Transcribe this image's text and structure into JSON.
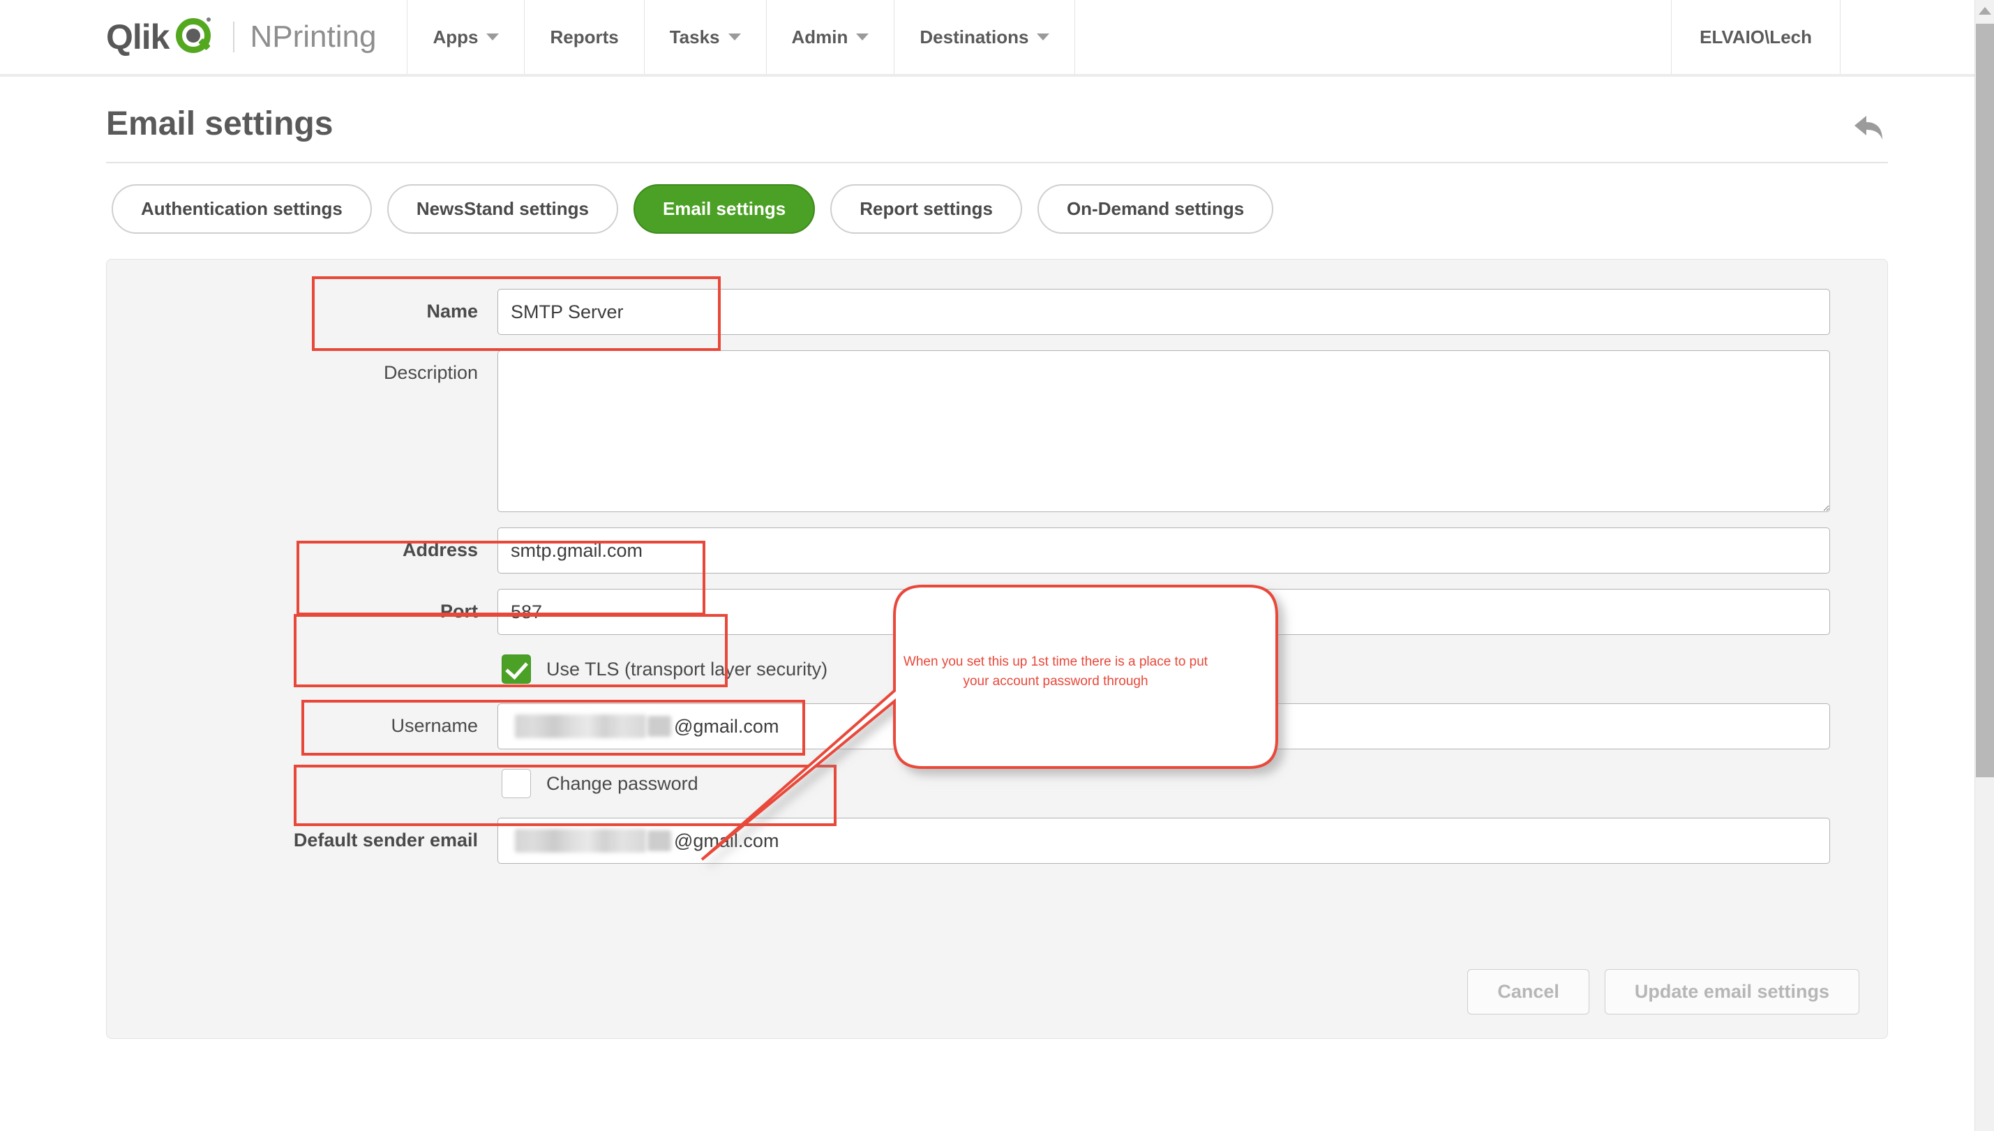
{
  "navbar": {
    "logo": {
      "brand": "Qlik",
      "product": "NPrinting"
    },
    "items": [
      {
        "label": "Apps",
        "has_caret": true
      },
      {
        "label": "Reports",
        "has_caret": false
      },
      {
        "label": "Tasks",
        "has_caret": true
      },
      {
        "label": "Admin",
        "has_caret": true
      },
      {
        "label": "Destinations",
        "has_caret": true
      }
    ],
    "user": "ELVAIO\\Lech"
  },
  "page": {
    "title": "Email settings",
    "back_icon": "back-arrow-icon"
  },
  "tabs": [
    {
      "label": "Authentication settings",
      "active": false
    },
    {
      "label": "NewsStand settings",
      "active": false
    },
    {
      "label": "Email settings",
      "active": true
    },
    {
      "label": "Report settings",
      "active": false
    },
    {
      "label": "On-Demand settings",
      "active": false
    }
  ],
  "form": {
    "name": {
      "label": "Name",
      "value": "SMTP Server",
      "placeholder": ""
    },
    "description": {
      "label": "Description",
      "value": "",
      "placeholder": ""
    },
    "address": {
      "label": "Address",
      "value": "smtp.gmail.com",
      "placeholder": ""
    },
    "port": {
      "label": "Port",
      "value": "587",
      "placeholder": ""
    },
    "use_tls": {
      "label": "Use TLS (transport layer security)",
      "checked": true
    },
    "username": {
      "label": "Username",
      "value_suffix": "@gmail.com",
      "redacted": true
    },
    "change_password": {
      "label": "Change password",
      "checked": false
    },
    "default_sender_email": {
      "label": "Default sender email",
      "value_suffix": "@gmail.com",
      "redacted": true
    }
  },
  "actions": {
    "cancel": "Cancel",
    "update": "Update email settings",
    "disabled": true
  },
  "annotation": {
    "callout_text": "When you set this up 1st time there is a place to put your account password through",
    "color": "#e8483a",
    "highlighted_fields": [
      "Name",
      "Address",
      "Port",
      "Use TLS (transport layer security)",
      "Username"
    ]
  },
  "colors": {
    "brand_green": "#4ba125",
    "annotation_red": "#e8483a",
    "panel_bg": "#f4f4f4",
    "text_gray": "#4a4a4a"
  }
}
